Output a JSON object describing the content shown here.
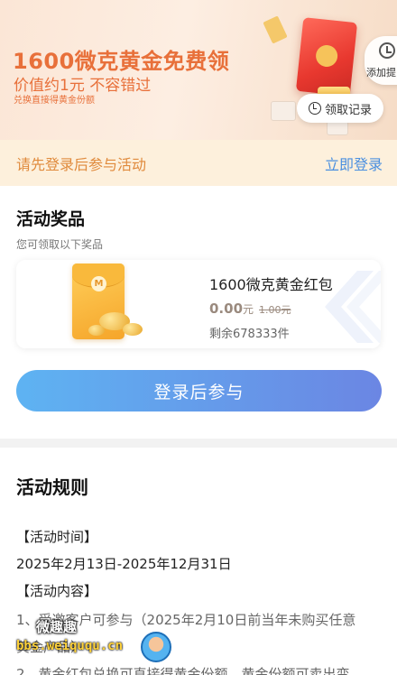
{
  "banner": {
    "title": "1600微克黄金免费领",
    "subtitle": "价值约1元 不容错过",
    "note": "兑换直接得黄金份额",
    "side_label": "添加提",
    "record_label": "领取记录"
  },
  "login_bar": {
    "hint": "请先登录后参与活动",
    "link": "立即登录"
  },
  "prizes": {
    "title": "活动奖品",
    "subtitle": "您可领取以下奖品",
    "item": {
      "logo": "M",
      "name": "1600微克黄金红包",
      "price_now": "0.00",
      "price_unit": "元",
      "price_old": "1.00元",
      "stock": "剩余678333件"
    },
    "cta": "登录后参与"
  },
  "rules": {
    "title": "活动规则",
    "lines": [
      "【活动时间】",
      "2025年2月13日-2025年12月31日",
      "【活动内容】",
      "1、受邀客户可参与（2025年2月10日前当年未购买任意",
      "黄金产品）",
      "2、黄金红包兑换可直接得黄金份额，黄金份额可卖出变"
    ]
  },
  "watermark": {
    "text1": "微趣趣",
    "text2": "bbs.weiququ.cn"
  },
  "colors": {
    "accent_orange": "#e8703a",
    "link_blue": "#4a8fe0",
    "cta_start": "#5eb3f2",
    "cta_end": "#6b86e3"
  }
}
